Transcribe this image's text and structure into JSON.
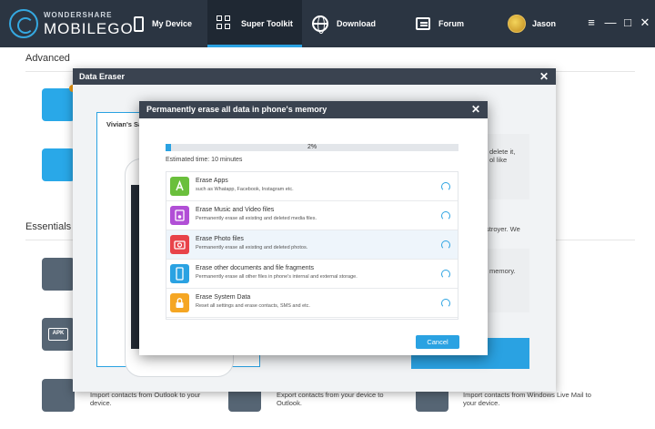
{
  "app": {
    "brand_small": "WONDERSHARE",
    "brand_big": "MOBILEGO",
    "nav": [
      {
        "label": "My Device",
        "icon": "phone-icon"
      },
      {
        "label": "Super Toolkit",
        "icon": "grid-icon"
      },
      {
        "label": "Download",
        "icon": "globe-icon"
      },
      {
        "label": "Forum",
        "icon": "forum-icon"
      }
    ],
    "user_name": "Jason",
    "window_controls": [
      "≡",
      "—",
      "□",
      "✕"
    ],
    "accent": "#2aa2e2",
    "header_bg": "#2b3542"
  },
  "background": {
    "section_advanced": "Advanced",
    "section_essentials": "Essentials",
    "right_snippet_1": "delete it,",
    "right_snippet_2": "ol like",
    "right_snippet_3": "stroyer. We",
    "right_snippet_4": "memory.",
    "bottom_items": [
      "Import contacts from Outlook to your device.",
      "Export contacts from your device to Outlook.",
      "Import contacts from Windows Live Mail to your device."
    ],
    "apk_label": "APK"
  },
  "eraser_dialog": {
    "title": "Data Eraser",
    "device_name": "Vivian's Sa"
  },
  "erase_dialog": {
    "title": "Permanently erase all data in phone's memory",
    "progress_text": "2%",
    "progress_value": 0.02,
    "estimated_time": "Estimated time:  10 minutes",
    "items": [
      {
        "title": "Erase Apps",
        "desc": "such as Whatapp, Facebook, Instagram etc.",
        "color": "#6abf3c",
        "icon": "app-store-icon"
      },
      {
        "title": "Erase Music and Video files",
        "desc": "Permanently erase all existing and deleted media files.",
        "color": "#b14fd6",
        "icon": "media-icon"
      },
      {
        "title": "Erase Photo files",
        "desc": "Permanently erase all existing and deleted photos.",
        "color": "#e84349",
        "icon": "camera-icon"
      },
      {
        "title": "Erase other documents and file fragments",
        "desc": "Permanently erase all other files in phone's internal and external storage.",
        "color": "#2aa2e2",
        "icon": "phone-icon"
      },
      {
        "title": "Erase System Data",
        "desc": "Reset all settings and erase contacts, SMS and etc.",
        "color": "#f5a623",
        "icon": "lock-icon"
      }
    ],
    "cancel_label": "Cancel"
  }
}
